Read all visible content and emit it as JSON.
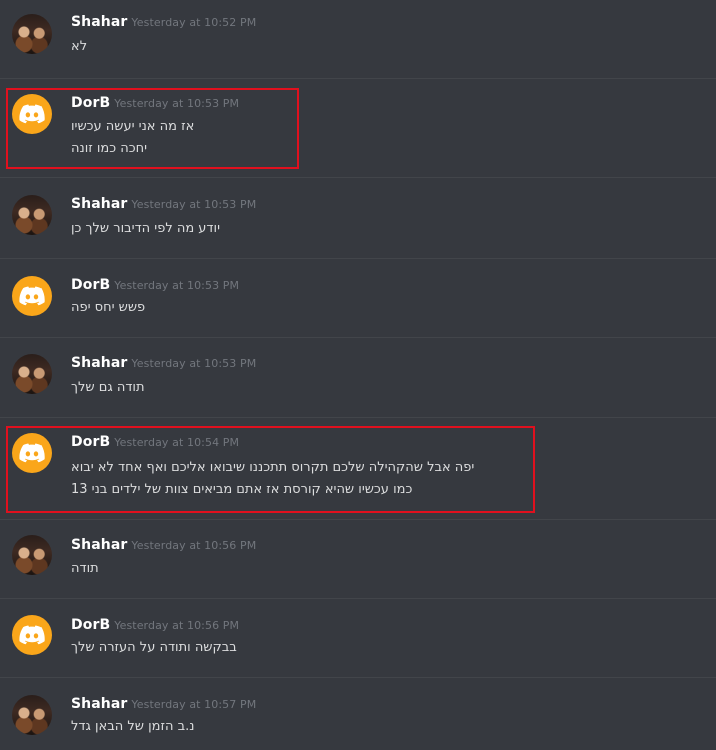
{
  "messages": [
    {
      "author": "Shahar",
      "timestamp": "Yesterday at 10:52 PM",
      "avatar": "shahar-avatar",
      "lines": [
        "לא"
      ]
    },
    {
      "author": "DorB",
      "timestamp": "Yesterday at 10:53 PM",
      "avatar": "discord-logo-icon",
      "lines": [
        "אז מה אני יעשה עכשיו",
        "יחכה כמו זונה"
      ],
      "highlighted": true
    },
    {
      "author": "Shahar",
      "timestamp": "Yesterday at 10:53 PM",
      "avatar": "shahar-avatar",
      "lines": [
        "יודע מה לפי הדיבור שלך כן"
      ]
    },
    {
      "author": "DorB",
      "timestamp": "Yesterday at 10:53 PM",
      "avatar": "discord-logo-icon",
      "lines": [
        "פשש יחס יפה"
      ]
    },
    {
      "author": "Shahar",
      "timestamp": "Yesterday at 10:53 PM",
      "avatar": "shahar-avatar",
      "lines": [
        "תודה גם שלך"
      ]
    },
    {
      "author": "DorB",
      "timestamp": "Yesterday at 10:54 PM",
      "avatar": "discord-logo-icon",
      "lines": [
        "יפה אבל שהקהילה שלכם תקרוס תתכננו שיבואו אליכם ואף אחד לא יבוא",
        "כמו עכשיו שהיא קורסת אז אתם מביאים צוות של ילדים בני 13"
      ],
      "highlighted": true
    },
    {
      "author": "Shahar",
      "timestamp": "Yesterday at 10:56 PM",
      "avatar": "shahar-avatar",
      "lines": [
        "תודה"
      ]
    },
    {
      "author": "DorB",
      "timestamp": "Yesterday at 10:56 PM",
      "avatar": "discord-logo-icon",
      "lines": [
        "בבקשה ותודה על העזרה שלך"
      ]
    },
    {
      "author": "Shahar",
      "timestamp": "Yesterday at 10:57 PM",
      "avatar": "shahar-avatar",
      "lines": [
        "נ.ב הזמן של הבאן גדל"
      ]
    }
  ],
  "colors": {
    "background": "#36393f",
    "highlight": "#e0101e",
    "discord_orange": "#faa61a",
    "text": "#dcddde",
    "timestamp": "#72767d"
  }
}
